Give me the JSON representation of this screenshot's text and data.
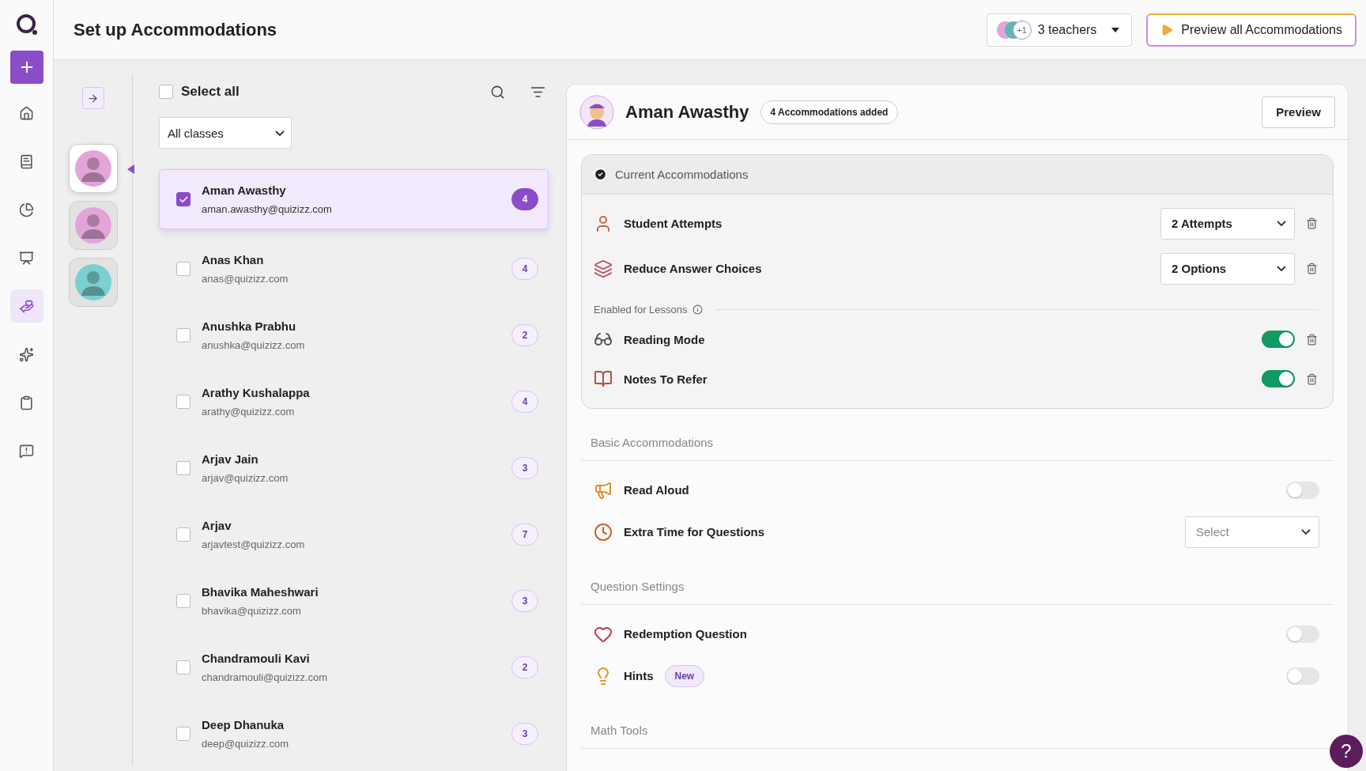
{
  "nav": {
    "items": [
      {
        "selected": false
      },
      {
        "selected": false
      },
      {
        "selected": false
      },
      {
        "selected": false
      },
      {
        "selected": true
      },
      {
        "selected": false
      },
      {
        "selected": false
      },
      {
        "selected": false
      }
    ]
  },
  "header": {
    "title": "Set up Accommodations",
    "teachers": {
      "extra": "+1",
      "label": "3 teachers"
    },
    "preview_all": "Preview all Accommodations"
  },
  "classes": [
    {
      "selected": true,
      "color": "#e3a4d8"
    },
    {
      "selected": false,
      "color": "#e3a4d8"
    },
    {
      "selected": false,
      "color": "#7ccfcf"
    }
  ],
  "students": {
    "select_all": {
      "label": "Select all",
      "checked": false
    },
    "filter": "All classes",
    "items": [
      {
        "name": "Aman Awasthy",
        "email": "aman.awasthy@quizizz.com",
        "count": "4",
        "checked": true,
        "selected": true
      },
      {
        "name": "Anas Khan",
        "email": "anas@quizizz.com",
        "count": "4",
        "checked": false,
        "selected": false
      },
      {
        "name": "Anushka Prabhu",
        "email": "anushka@quizizz.com",
        "count": "2",
        "checked": false,
        "selected": false
      },
      {
        "name": "Arathy Kushalappa",
        "email": "arathy@quizizz.com",
        "count": "4",
        "checked": false,
        "selected": false
      },
      {
        "name": "Arjav Jain",
        "email": "arjav@quizizz.com",
        "count": "3",
        "checked": false,
        "selected": false
      },
      {
        "name": "Arjav",
        "email": "arjavtest@quizizz.com",
        "count": "7",
        "checked": false,
        "selected": false
      },
      {
        "name": "Bhavika Maheshwari",
        "email": "bhavika@quizizz.com",
        "count": "3",
        "checked": false,
        "selected": false
      },
      {
        "name": "Chandramouli Kavi",
        "email": "chandramouli@quizizz.com",
        "count": "2",
        "checked": false,
        "selected": false
      },
      {
        "name": "Deep Dhanuka",
        "email": "deep@quizizz.com",
        "count": "3",
        "checked": false,
        "selected": false
      }
    ]
  },
  "detail": {
    "name": "Aman Awasthy",
    "badge": "4 Accommodations added",
    "preview": "Preview",
    "current": {
      "title": "Current Accommodations",
      "items": [
        {
          "kind": "select",
          "label": "Student Attempts",
          "value": "2 Attempts"
        },
        {
          "kind": "select",
          "label": "Reduce Answer Choices",
          "value": "2 Options"
        }
      ],
      "lessons_label": "Enabled for Lessons",
      "lessons": [
        {
          "kind": "toggle",
          "label": "Reading Mode",
          "on": true
        },
        {
          "kind": "toggle",
          "label": "Notes To Refer",
          "on": true
        }
      ]
    },
    "sections": [
      {
        "title": "Basic Accommodations",
        "items": [
          {
            "kind": "toggle",
            "label": "Read Aloud",
            "on": false
          },
          {
            "kind": "select",
            "label": "Extra Time for Questions",
            "placeholder": "Select"
          }
        ]
      },
      {
        "title": "Question Settings",
        "items": [
          {
            "kind": "toggle",
            "label": "Redemption Question",
            "on": false
          },
          {
            "kind": "toggle",
            "label": "Hints",
            "badge": "New",
            "on": false
          }
        ]
      },
      {
        "title": "Math Tools"
      }
    ]
  },
  "help": "?"
}
